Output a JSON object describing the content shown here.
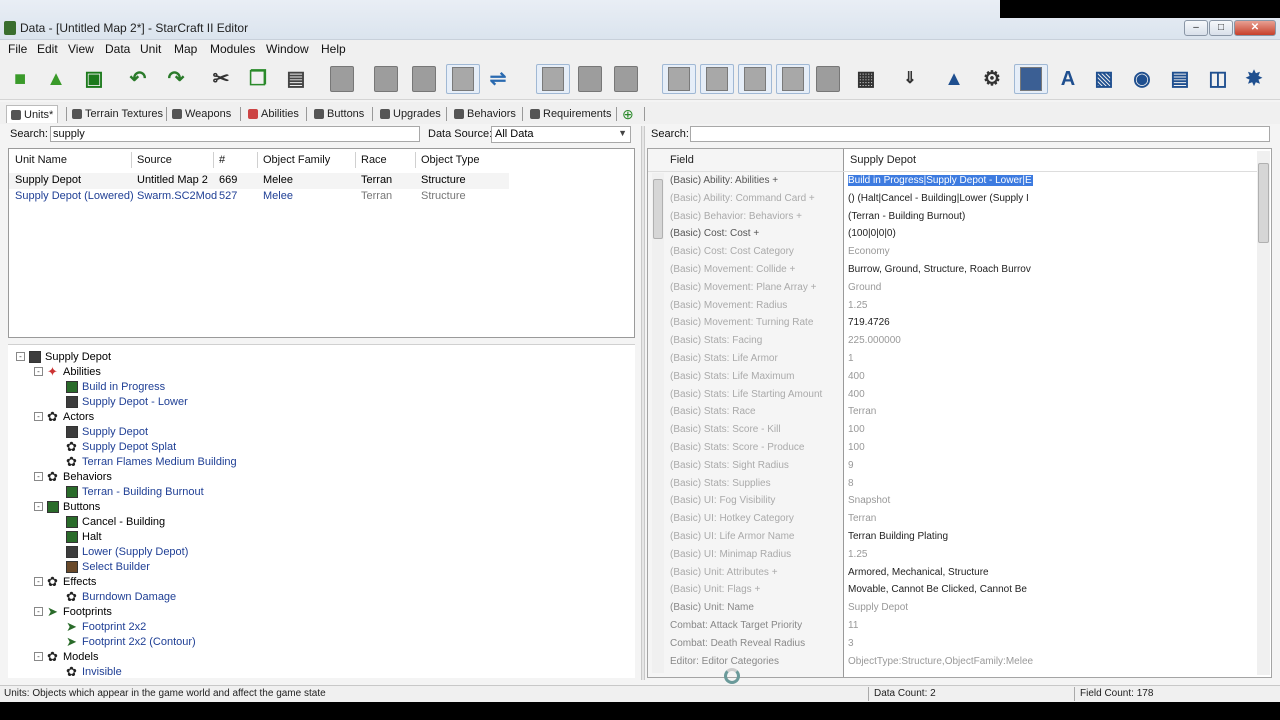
{
  "window": {
    "title": "Data - [Untitled Map 2*] - StarCraft II Editor"
  },
  "menu": [
    "File",
    "Edit",
    "View",
    "Data",
    "Unit",
    "Map",
    "Modules",
    "Window",
    "Help"
  ],
  "tabs": [
    {
      "label": "Units*",
      "icon": "unit-icon"
    },
    {
      "label": "Terrain Textures",
      "icon": "terrain-icon"
    },
    {
      "label": "Weapons",
      "icon": "weapon-icon"
    },
    {
      "label": "Abilities",
      "icon": "ability-icon"
    },
    {
      "label": "Buttons",
      "icon": "button-icon"
    },
    {
      "label": "Upgrades",
      "icon": "upgrade-icon"
    },
    {
      "label": "Behaviors",
      "icon": "behavior-icon"
    },
    {
      "label": "Requirements",
      "icon": "requirement-icon"
    }
  ],
  "left": {
    "search_label": "Search:",
    "search_value": "supply",
    "datasource_label": "Data Source:",
    "datasource_value": "All Data",
    "columns": [
      "Unit Name",
      "Source",
      "#",
      "Object Family",
      "Race",
      "Object Type"
    ],
    "rows": [
      [
        "Supply Depot",
        "Untitled Map 2",
        "669",
        "Melee",
        "Terran",
        "Structure"
      ],
      [
        "Supply Depot  (Lowered)",
        "Swarm.SC2Mod",
        "527",
        "Melee",
        "Terran",
        "Structure"
      ]
    ]
  },
  "tree": {
    "root": "Supply Depot",
    "groups": [
      {
        "label": "Abilities",
        "children": [
          "Build in Progress",
          "Supply Depot - Lower"
        ]
      },
      {
        "label": "Actors",
        "children": [
          "Supply Depot",
          "Supply Depot Splat",
          "Terran Flames Medium Building"
        ]
      },
      {
        "label": "Behaviors",
        "children": [
          "Terran - Building Burnout"
        ]
      },
      {
        "label": "Buttons",
        "children": [
          "Cancel  - Building",
          "Halt",
          "Lower (Supply Depot)",
          "Select Builder"
        ]
      },
      {
        "label": "Effects",
        "children": [
          "Burndown Damage"
        ]
      },
      {
        "label": "Footprints",
        "children": [
          "Footprint 2x2",
          "Footprint 2x2 (Contour)"
        ]
      },
      {
        "label": "Models",
        "children": [
          "Invisible"
        ]
      }
    ]
  },
  "right": {
    "search_label": "Search:",
    "search_value": "",
    "field_header": "Field",
    "value_header": "Supply Depot",
    "fields": [
      [
        "(Basic) Ability: Abilities +",
        "Build in Progress|Supply Depot - Lower|E"
      ],
      [
        "(Basic) Ability: Command Card +",
        "() (Halt|Cancel  - Building|Lower (Supply I"
      ],
      [
        "(Basic) Behavior: Behaviors +",
        "(Terran - Building Burnout)"
      ],
      [
        "(Basic) Cost: Cost +",
        "(100|0|0|0)"
      ],
      [
        "(Basic) Cost: Cost Category",
        "Economy"
      ],
      [
        "(Basic) Movement: Collide +",
        "Burrow, Ground, Structure, Roach Burrov"
      ],
      [
        "(Basic) Movement: Plane Array +",
        "Ground"
      ],
      [
        "(Basic) Movement: Radius",
        "1.25"
      ],
      [
        "(Basic) Movement: Turning Rate",
        "719.4726"
      ],
      [
        "(Basic) Stats: Facing",
        "225.000000"
      ],
      [
        "(Basic) Stats: Life Armor",
        "1"
      ],
      [
        "(Basic) Stats: Life Maximum",
        "400"
      ],
      [
        "(Basic) Stats: Life Starting Amount",
        "400"
      ],
      [
        "(Basic) Stats: Race",
        "Terran"
      ],
      [
        "(Basic) Stats: Score - Kill",
        "100"
      ],
      [
        "(Basic) Stats: Score - Produce",
        "100"
      ],
      [
        "(Basic) Stats: Sight Radius",
        "9"
      ],
      [
        "(Basic) Stats: Supplies",
        "8"
      ],
      [
        "(Basic) UI: Fog Visibility",
        "Snapshot"
      ],
      [
        "(Basic) UI: Hotkey Category",
        "Terran"
      ],
      [
        "(Basic) UI: Life Armor Name",
        "Terran Building Plating"
      ],
      [
        "(Basic) UI: Minimap Radius",
        "1.25"
      ],
      [
        "(Basic) Unit: Attributes +",
        "Armored, Mechanical, Structure"
      ],
      [
        "(Basic) Unit: Flags +",
        "Movable, Cannot Be Clicked, Cannot Be"
      ],
      [
        "(Basic) Unit: Name",
        "Supply Depot"
      ],
      [
        "Combat: Attack Target Priority",
        "11"
      ],
      [
        "Combat: Death Reveal Radius",
        "3"
      ],
      [
        "Editor: Editor Categories",
        "ObjectType:Structure,ObjectFamily:Melee"
      ]
    ]
  },
  "status": {
    "text": "Units: Objects which appear in the game world and affect the game state",
    "data_count": "Data Count: 2",
    "field_count": "Field Count: 178"
  }
}
